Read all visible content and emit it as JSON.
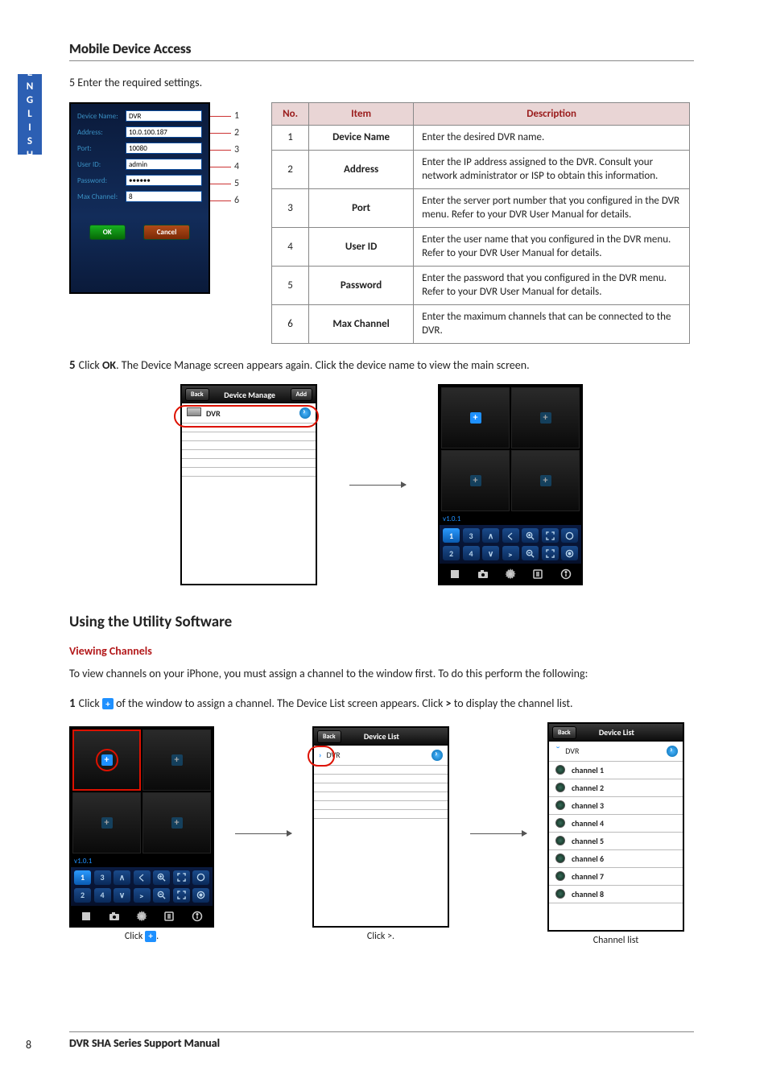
{
  "lang_tab": "ENGLISH",
  "section_head": "Mobile Device Access",
  "intro": "5 Enter the required settings.",
  "form": {
    "rows": [
      {
        "label": "Device Name:",
        "value": "DVR"
      },
      {
        "label": "Address:",
        "value": "10.0.100.187"
      },
      {
        "label": "Port:",
        "value": "10080"
      },
      {
        "label": "User ID:",
        "value": "admin"
      },
      {
        "label": "Password:",
        "value": "••••••"
      },
      {
        "label": "Max Channel:",
        "value": "8"
      }
    ],
    "ok": "OK",
    "cancel": "Cancel"
  },
  "callouts": [
    "1",
    "2",
    "3",
    "4",
    "5",
    "6"
  ],
  "table": {
    "headers": [
      "No.",
      "Item",
      "Description"
    ],
    "rows": [
      {
        "no": "1",
        "item": "Device Name",
        "desc": "Enter the desired DVR name."
      },
      {
        "no": "2",
        "item": "Address",
        "desc": "Enter the IP address assigned to the DVR. Consult your network administrator or ISP to obtain this information."
      },
      {
        "no": "3",
        "item": "Port",
        "desc": "Enter the server port number that you configured in the DVR menu. Refer to your DVR User Manual for details."
      },
      {
        "no": "4",
        "item": "User ID",
        "desc": "Enter the user name that you configured in the DVR menu. Refer to your DVR User Manual for details."
      },
      {
        "no": "5",
        "item": "Password",
        "desc": "Enter the password that you configured in the DVR menu. Refer to your DVR User Manual for details."
      },
      {
        "no": "6",
        "item": "Max Channel",
        "desc": "Enter the maximum channels that can be connected to the DVR."
      }
    ]
  },
  "step5": {
    "n": "5",
    "pre": "Click ",
    "bold": "OK",
    "post": ". The Device Manage screen appears again. Click the device name to view the main screen."
  },
  "dm_bar": {
    "back": "Back",
    "title": "Device Manage",
    "add": "Add",
    "item": "DVR"
  },
  "live": {
    "version": "v1.0.1"
  },
  "ctrl_nums": [
    "1",
    "3",
    "2",
    "4"
  ],
  "util_head": "Using the Utility Software",
  "sub_head": "Viewing Channels",
  "para1": "To view channels on your iPhone, you must assign a channel to the window first. To do this perform the following:",
  "step1": {
    "n": "1",
    "pre": "Click ",
    "mid": " of the window to assign a channel. The Device List screen appears. Click ",
    "bold": ">",
    "post": " to display the channel list."
  },
  "dl_bar": {
    "back": "Back",
    "title": "Device List",
    "item": "DVR"
  },
  "channels": [
    "channel 1",
    "channel 2",
    "channel 3",
    "channel 4",
    "channel 5",
    "channel 6",
    "channel 7",
    "channel 8"
  ],
  "captions": {
    "a": "Click ",
    "a2": ".",
    "b": "Click >.",
    "c": "Channel list"
  },
  "footer": "DVR SHA Series Support Manual",
  "page": "8"
}
